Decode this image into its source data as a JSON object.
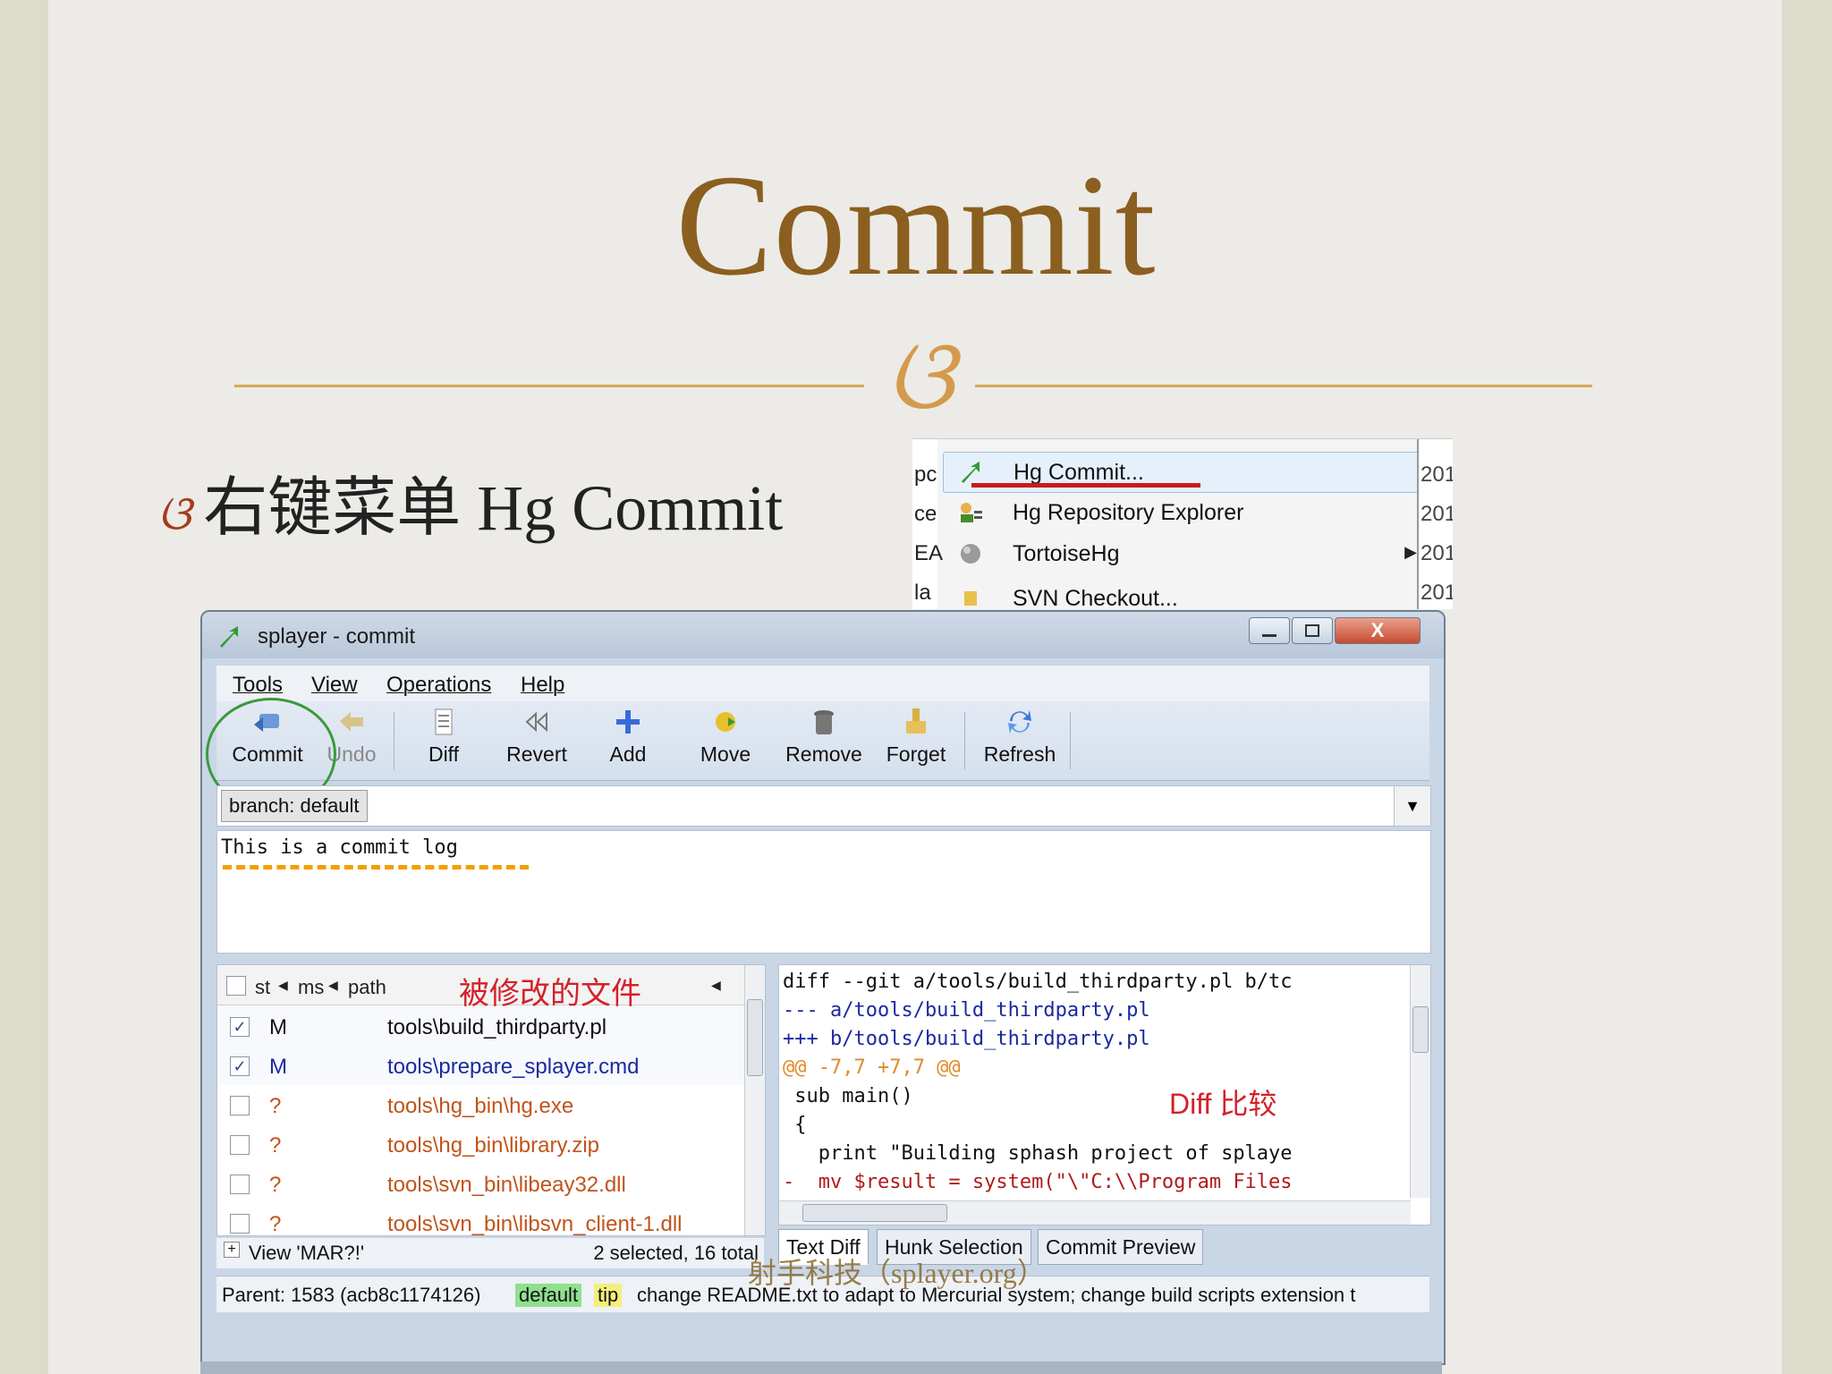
{
  "slide": {
    "title": "Commit",
    "ornament": "ଓ",
    "bullet_glyph": "ଓ",
    "bullet_text": "右键菜单 Hg Commit",
    "watermark": "射手科技（splayer.org）"
  },
  "context_menu": {
    "items": [
      {
        "label": "Hg Commit...",
        "icon": "hg-commit-icon"
      },
      {
        "label": "Hg Repository Explorer",
        "icon": "hg-repo-explorer-icon"
      },
      {
        "label": "TortoiseHg",
        "icon": "tortoisehg-icon",
        "submenu_arrow": "▶"
      },
      {
        "label": "SVN Checkout...",
        "icon": "svn-icon"
      }
    ],
    "left_col_fragments": [
      "pc",
      "ce",
      "EA",
      "la"
    ],
    "right_col_fragments": [
      "201",
      "201",
      "201",
      "201"
    ]
  },
  "window": {
    "title": "splayer - commit",
    "controls": {
      "minimize": "—",
      "maximize": "☐",
      "close": "X"
    },
    "menu": [
      "Tools",
      "View",
      "Operations",
      "Help"
    ],
    "toolbar": [
      {
        "label": "Commit",
        "icon": "commit-icon",
        "enabled": true
      },
      {
        "label": "Undo",
        "icon": "undo-icon",
        "enabled": false
      },
      {
        "label": "Diff",
        "icon": "diff-icon",
        "enabled": true
      },
      {
        "label": "Revert",
        "icon": "revert-icon",
        "enabled": true
      },
      {
        "label": "Add",
        "icon": "add-icon",
        "enabled": true
      },
      {
        "label": "Move",
        "icon": "move-icon",
        "enabled": true
      },
      {
        "label": "Remove",
        "icon": "remove-icon",
        "enabled": true
      },
      {
        "label": "Forget",
        "icon": "forget-icon",
        "enabled": true
      },
      {
        "label": "Refresh",
        "icon": "refresh-icon",
        "enabled": true
      }
    ],
    "branch_label": "branch: default",
    "commit_message": "This is a commit log",
    "file_list": {
      "columns": [
        "st",
        "ms",
        "path"
      ],
      "annotation": "被修改的文件",
      "rows": [
        {
          "checked": true,
          "status": "M",
          "path": "tools\\build_thirdparty.pl",
          "color": "#111111"
        },
        {
          "checked": true,
          "status": "M",
          "path": "tools\\prepare_splayer.cmd",
          "color": "#1a2aa0"
        },
        {
          "checked": false,
          "status": "?",
          "path": "tools\\hg_bin\\hg.exe",
          "color": "#c0541a"
        },
        {
          "checked": false,
          "status": "?",
          "path": "tools\\hg_bin\\library.zip",
          "color": "#c0541a"
        },
        {
          "checked": false,
          "status": "?",
          "path": "tools\\svn_bin\\libeay32.dll",
          "color": "#c0541a"
        },
        {
          "checked": false,
          "status": "?",
          "path": "tools\\svn_bin\\libsvn_client-1.dll",
          "color": "#c0541a"
        }
      ],
      "footer_view": "View 'MAR?!'",
      "footer_count": "2 selected, 16 total"
    },
    "diff": {
      "annotation": "Diff 比较",
      "lines": [
        {
          "text": "diff --git a/tools/build_thirdparty.pl b/tc",
          "color": "#111111"
        },
        {
          "text": "--- a/tools/build_thirdparty.pl",
          "color": "#1a2aa0"
        },
        {
          "text": "+++ b/tools/build_thirdparty.pl",
          "color": "#1a2aa0"
        },
        {
          "text": "@@ -7,7 +7,7 @@",
          "color": "#e08a2a"
        },
        {
          "text": " sub main()",
          "color": "#111111"
        },
        {
          "text": " {",
          "color": "#111111"
        },
        {
          "text": "   print \"Building sphash project of splaye",
          "color": "#111111"
        },
        {
          "text": "-  mv $result = system(\"\\\"C:\\\\Program Files",
          "color": "#b01a1a"
        }
      ],
      "tabs": [
        "Text Diff",
        "Hunk Selection",
        "Commit Preview"
      ]
    },
    "status": {
      "parent": "Parent: 1583 (acb8c1174126)",
      "tag_default": "default",
      "tag_tip": "tip",
      "message": "change README.txt to adapt to Mercurial system; change build scripts extension t"
    }
  },
  "colors": {
    "title": "#8b5f1f",
    "ornament": "#d49a4c",
    "annotation_red": "#d4202a",
    "highlight_green": "#3a9a3a",
    "dash_orange": "#f0a000"
  }
}
